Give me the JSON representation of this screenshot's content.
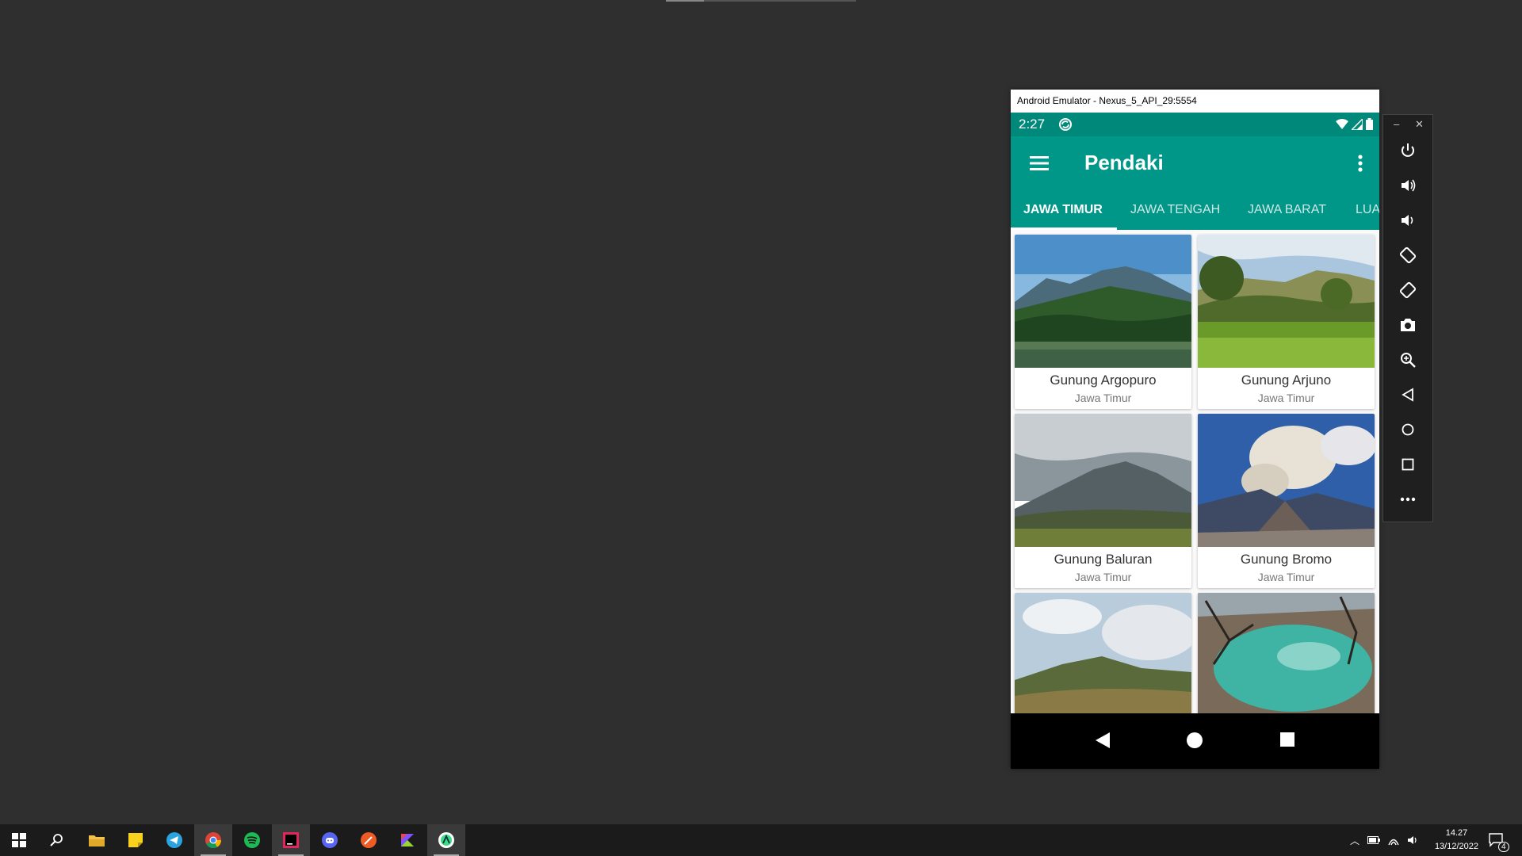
{
  "window": {
    "title": "Android Emulator - Nexus_5_API_29:5554"
  },
  "statusbar": {
    "time": "2:27"
  },
  "appbar": {
    "title": "Pendaki"
  },
  "tabs": [
    {
      "label": "JAWA TIMUR",
      "active": true
    },
    {
      "label": "JAWA TENGAH",
      "active": false
    },
    {
      "label": "JAWA BARAT",
      "active": false
    },
    {
      "label": "LUA",
      "active": false
    }
  ],
  "mountains": [
    {
      "name": "Gunung Argopuro",
      "region": "Jawa Timur"
    },
    {
      "name": "Gunung Arjuno",
      "region": "Jawa Timur"
    },
    {
      "name": "Gunung Baluran",
      "region": "Jawa Timur"
    },
    {
      "name": "Gunung Bromo",
      "region": "Jawa Timur"
    },
    {
      "name": "",
      "region": ""
    },
    {
      "name": "",
      "region": ""
    }
  ],
  "side_panel": {
    "buttons": [
      "power-icon",
      "volume-up-icon",
      "volume-down-icon",
      "rotate-left-icon",
      "rotate-right-icon",
      "camera-icon",
      "zoom-icon",
      "back-icon",
      "home-icon",
      "overview-icon",
      "more-icon"
    ]
  },
  "taskbar": {
    "apps": [
      "start-icon",
      "search-icon",
      "file-explorer-icon",
      "sticky-notes-icon",
      "telegram-icon",
      "chrome-icon",
      "spotify-icon",
      "intellij-icon",
      "discord-icon",
      "postman-icon",
      "kotlin-icon",
      "android-studio-icon"
    ],
    "clock_time": "14.27",
    "clock_date": "13/12/2022",
    "notification_count": "4"
  },
  "colors": {
    "primary": "#009688",
    "primary_dark": "#00897b",
    "desktop": "#2f2f2f"
  }
}
